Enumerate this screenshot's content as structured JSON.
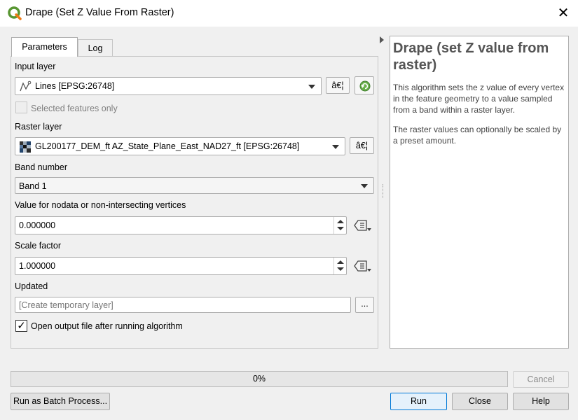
{
  "window": {
    "title": "Drape (Set Z Value From Raster)",
    "close_glyph": "✕"
  },
  "tabs": [
    {
      "label": "Parameters",
      "active": true
    },
    {
      "label": "Log",
      "active": false
    }
  ],
  "params": {
    "input_layer": {
      "label": "Input layer",
      "value": "Lines [EPSG:26748]",
      "more_glyph": "â€¦"
    },
    "selected_only": {
      "label": "Selected features only",
      "checked": false
    },
    "raster_layer": {
      "label": "Raster layer",
      "value": "GL200177_DEM_ft AZ_State_Plane_East_NAD27_ft [EPSG:26748]",
      "more_glyph": "â€¦"
    },
    "band": {
      "label": "Band number",
      "value": "Band 1"
    },
    "nodata": {
      "label": "Value for nodata or non-intersecting vertices",
      "value": "0.000000"
    },
    "scale": {
      "label": "Scale factor",
      "value": "1.000000"
    },
    "updated": {
      "label": "Updated",
      "placeholder": "[Create temporary layer]",
      "browse_label": "..."
    },
    "open_output": {
      "label": "Open output file after running algorithm",
      "checked": true,
      "check_glyph": "✓"
    }
  },
  "help": {
    "title": "Drape (set Z value from raster)",
    "p1": "This algorithm sets the z value of every vertex in the feature geometry to a value sampled from a band within a raster layer.",
    "p2": "The raster values can optionally be scaled by a preset amount."
  },
  "progress": {
    "text": "0%",
    "value": 0
  },
  "buttons": {
    "cancel": "Cancel",
    "batch": "Run as Batch Process...",
    "run": "Run",
    "close": "Close",
    "help": "Help"
  },
  "colors": {
    "accent": "#0078d7",
    "qgis_green": "#589632"
  },
  "icons": [
    "qgis-logo-icon",
    "close-icon",
    "line-layer-icon",
    "raster-layer-icon",
    "refresh-icon",
    "data-defined-icon",
    "dropdown-arrow-icon",
    "spin-up-icon",
    "spin-down-icon",
    "checkmark-icon",
    "collapse-arrow-icon"
  ]
}
